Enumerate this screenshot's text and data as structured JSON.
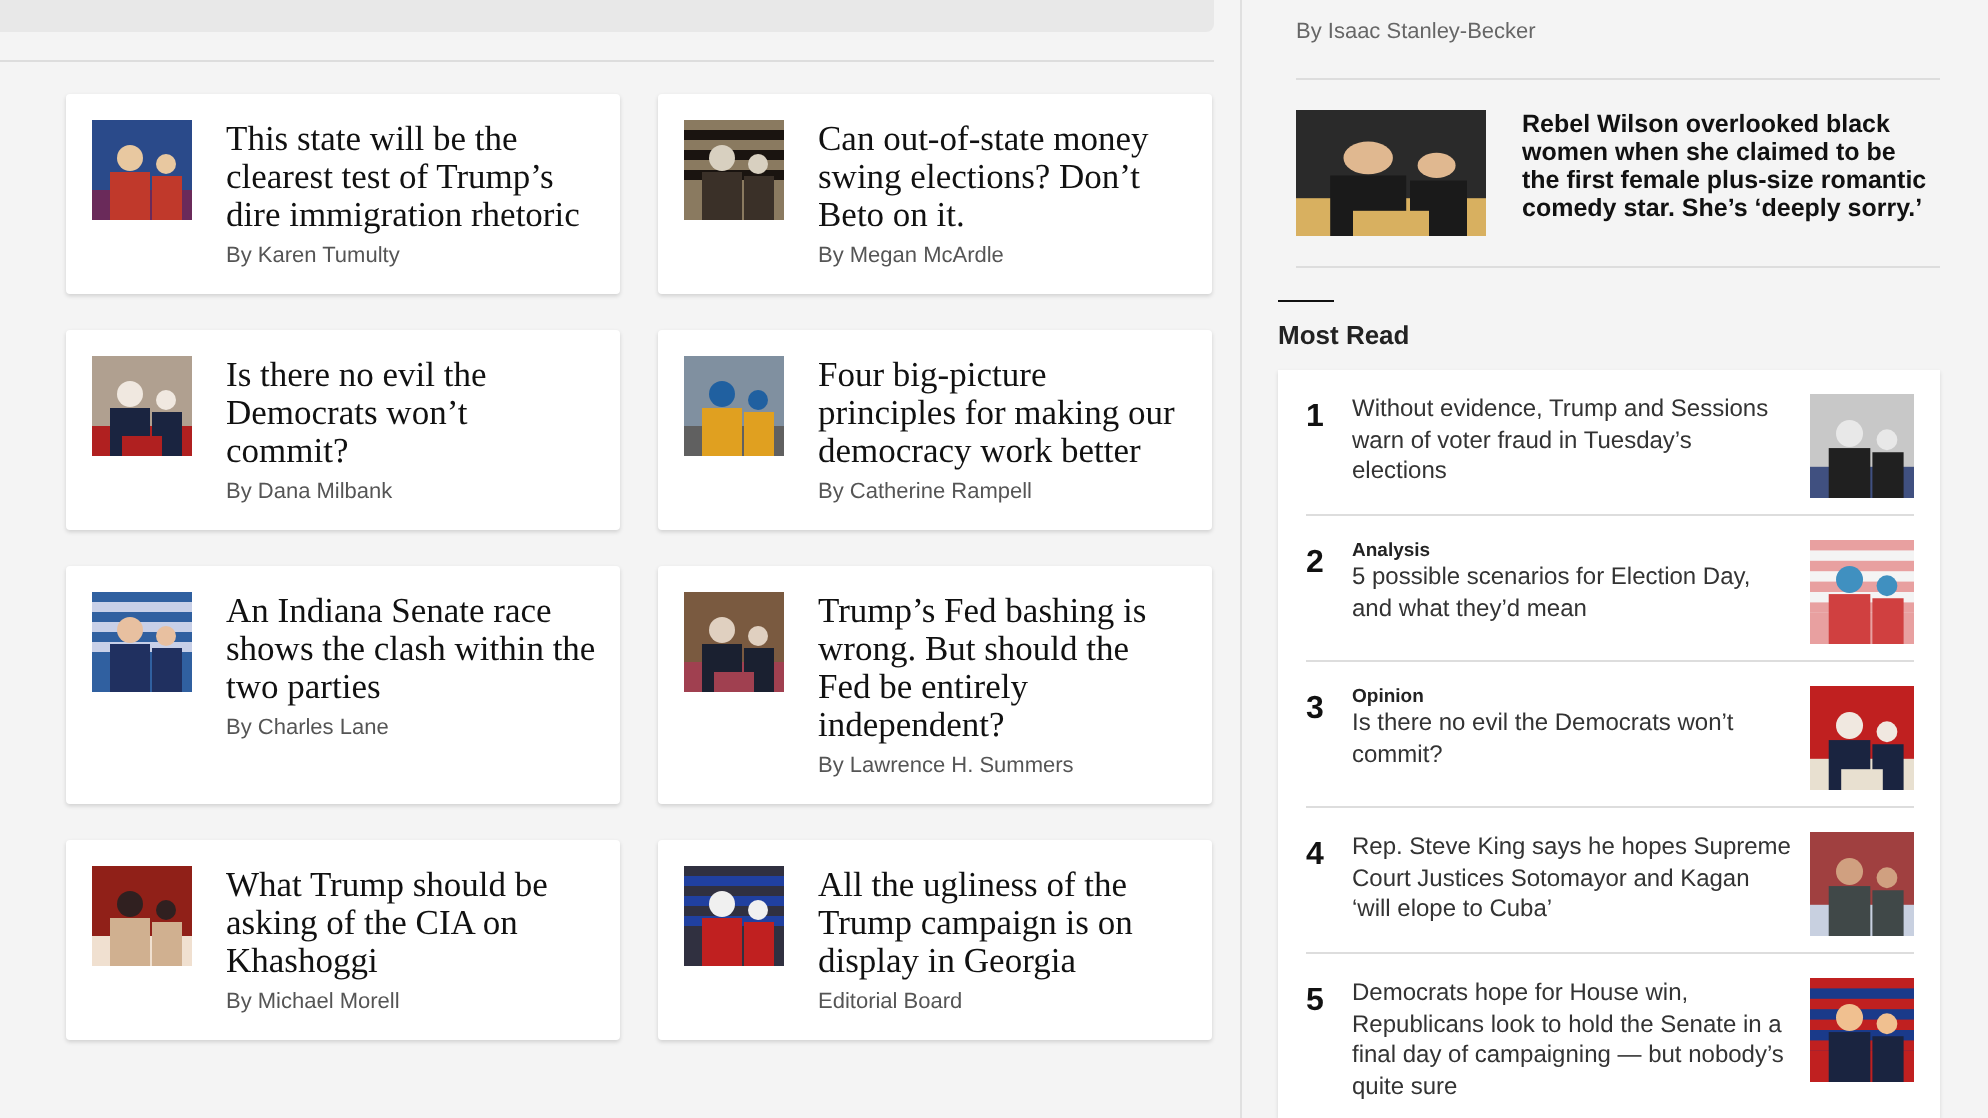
{
  "cards": [
    {
      "title": "This state will be the clearest test of Trump’s dire immigration rhetoric",
      "byline": "By Karen Tumulty"
    },
    {
      "title": "Can out-of-state money swing elections? Don’t Beto on it.",
      "byline": "By Megan McArdle"
    },
    {
      "title": "Is there no evil the Democrats won’t commit?",
      "byline": "By Dana Milbank"
    },
    {
      "title": "Four big-picture principles for making our democracy work better",
      "byline": "By Catherine Rampell"
    },
    {
      "title": "An Indiana Senate race shows the clash within the two parties",
      "byline": "By Charles Lane"
    },
    {
      "title": "Trump’s Fed bashing is wrong. But should the Fed be entirely independent?",
      "byline": "By Lawrence H. Summers"
    },
    {
      "title": "What Trump should be asking of the CIA on Khashoggi",
      "byline": "By Michael Morell"
    },
    {
      "title": "All the ugliness of the Trump campaign is on display in Georgia",
      "byline": "Editorial Board"
    }
  ],
  "sidebar": {
    "byline": "By Isaac Stanley-Becker",
    "feature": {
      "title": "Rebel Wilson overlooked black women when she claimed to be the first female plus-size romantic comedy star. She’s ‘deeply sorry.’"
    },
    "most_read": {
      "heading": "Most Read",
      "items": [
        {
          "number": "1",
          "title": "Without evidence, Trump and Sessions warn of voter fraud in Tuesday’s elections"
        },
        {
          "number": "2",
          "label": "Analysis",
          "title": "5 possible scenarios for Election Day, and what they’d mean"
        },
        {
          "number": "3",
          "label": "Opinion",
          "title": "Is there no evil the Democrats won’t commit?"
        },
        {
          "number": "4",
          "title": "Rep. Steve King says he hopes Supreme Court Justices Sotomayor and Kagan ‘will elope to Cuba’"
        },
        {
          "number": "5",
          "title": "Democrats hope for House win, Republicans look to hold the Senate in a final day of campaigning — but nobody’s quite sure"
        }
      ]
    }
  }
}
